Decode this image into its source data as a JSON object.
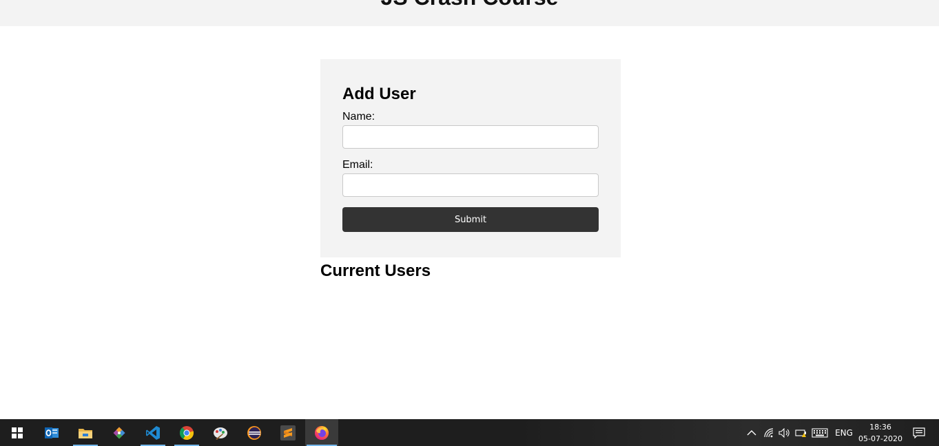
{
  "header": {
    "title": "JS Crash Course"
  },
  "form": {
    "title": "Add User",
    "name_label": "Name:",
    "name_value": "",
    "email_label": "Email:",
    "email_value": "",
    "submit_label": "Submit"
  },
  "users": {
    "title": "Current Users"
  },
  "taskbar": {
    "apps": [
      {
        "name": "outlook-icon"
      },
      {
        "name": "file-explorer-icon"
      },
      {
        "name": "git-icon"
      },
      {
        "name": "vscode-icon"
      },
      {
        "name": "chrome-icon"
      },
      {
        "name": "paint-icon"
      },
      {
        "name": "eclipse-icon"
      },
      {
        "name": "sublime-text-icon"
      },
      {
        "name": "firefox-icon",
        "active": true
      }
    ],
    "language": "ENG",
    "time": "18:36",
    "date": "05-07-2020"
  },
  "colors": {
    "button_bg": "#333333",
    "card_bg": "#f3f3f3",
    "taskbar_bg": "#1e1e1e",
    "taskbar_accent": "#76b9ed"
  }
}
